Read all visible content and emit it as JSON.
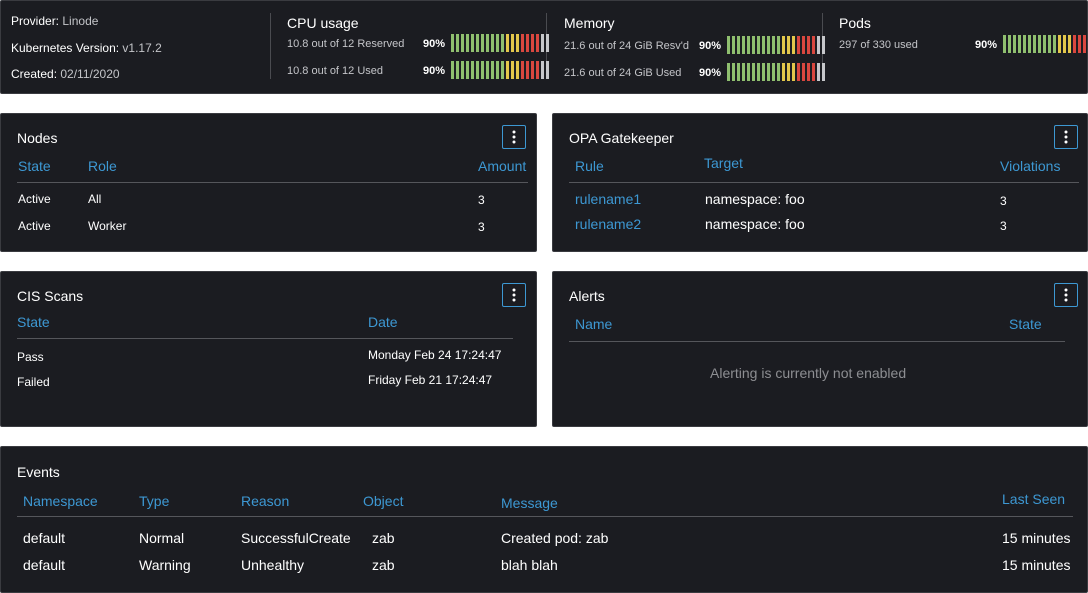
{
  "summary": {
    "provider_label": "Provider:",
    "provider_value": "Linode",
    "k8s_label": "Kubernetes Version:",
    "k8s_value": "v1.17.2",
    "created_label": "Created:",
    "created_value": "02/11/2020",
    "cpu": {
      "title": "CPU usage",
      "rows": [
        {
          "text": "10.8 out of 12 Reserved",
          "pct": "90%",
          "fill": 0.9
        },
        {
          "text": "10.8 out of 12 Used",
          "pct": "90%",
          "fill": 0.9
        }
      ]
    },
    "memory": {
      "title": "Memory",
      "rows": [
        {
          "text": "21.6 out of 24 GiB Resv'd",
          "pct": "90%",
          "fill": 0.9
        },
        {
          "text": "21.6 out of 24 GiB Used",
          "pct": "90%",
          "fill": 0.9
        }
      ]
    },
    "pods": {
      "title": "Pods",
      "rows": [
        {
          "text": "297 of 330 used",
          "pct": "90%",
          "fill": 0.9
        }
      ]
    },
    "bar_colors": {
      "green": "#8fbf6f",
      "yellow": "#e3c74b",
      "red": "#d9473f",
      "empty": "#c6c7cb"
    }
  },
  "nodes": {
    "title": "Nodes",
    "menu_icon": "kebab-menu-icon",
    "columns": [
      "State",
      "Role",
      "Amount"
    ],
    "rows": [
      {
        "state": "Active",
        "role": "All",
        "amount": "3"
      },
      {
        "state": "Active",
        "role": "Worker",
        "amount": "3"
      }
    ]
  },
  "opa": {
    "title": "OPA Gatekeeper",
    "menu_icon": "kebab-menu-icon",
    "columns": [
      "Rule",
      "Target",
      "Violations"
    ],
    "rows": [
      {
        "rule": "rulename1",
        "target": "namespace: foo",
        "violations": "3"
      },
      {
        "rule": "rulename2",
        "target": "namespace: foo",
        "violations": "3"
      }
    ]
  },
  "cis": {
    "title": "CIS Scans",
    "menu_icon": "kebab-menu-icon",
    "columns": [
      "State",
      "Date"
    ],
    "rows": [
      {
        "state": "Pass",
        "date": "Monday Feb 24 17:24:47"
      },
      {
        "state": "Failed",
        "date": "Friday Feb 21 17:24:47"
      }
    ]
  },
  "alerts": {
    "title": "Alerts",
    "menu_icon": "kebab-menu-icon",
    "columns": [
      "Name",
      "State"
    ],
    "empty_message": "Alerting is currently not enabled"
  },
  "events": {
    "title": "Events",
    "columns": [
      "Namespace",
      "Type",
      "Reason",
      "Object",
      "Message",
      "Last Seen"
    ],
    "rows": [
      {
        "namespace": "default",
        "type": "Normal",
        "reason": "SuccessfulCreate",
        "object": "zab",
        "message": "Created pod: zab",
        "last_seen": "15 minutes"
      },
      {
        "namespace": "default",
        "type": "Warning",
        "reason": "Unhealthy",
        "object": "zab",
        "message": "blah blah",
        "last_seen": "15 minutes"
      }
    ]
  }
}
